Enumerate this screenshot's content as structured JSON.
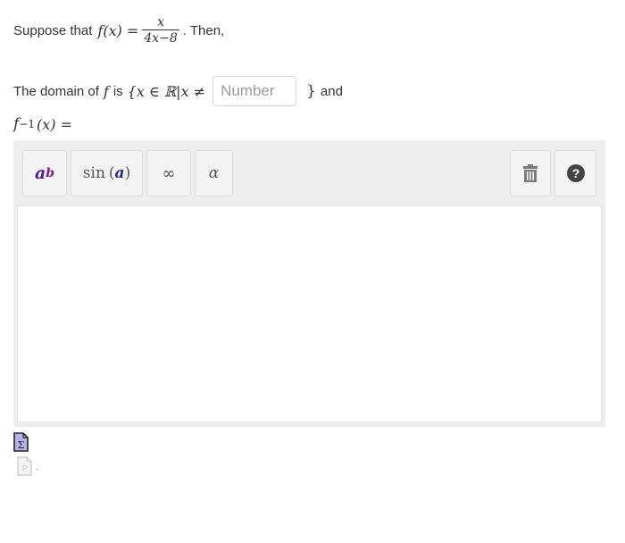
{
  "question": {
    "intro_text": "Suppose that",
    "function_lhs": "f(x) =",
    "fraction_numerator": "x",
    "fraction_denominator": "4x−8",
    "after_text": ". Then,"
  },
  "domain_line": {
    "prefix_text": "The domain of",
    "f_symbol": "f",
    "is_text": "is",
    "set_open": "{x ∈ ℝ|x ≠",
    "input_placeholder": "Number",
    "input_value": "",
    "set_close": "}",
    "and_text": "and"
  },
  "inverse_line": {
    "f": "f",
    "exponent": "−1",
    "rest": "(x) ="
  },
  "editor": {
    "toolbar": {
      "power_base": "a",
      "power_exp": "b",
      "trig_label": "sin",
      "trig_arg": "a",
      "infinity_label": "∞",
      "greek_label": "α",
      "trash_icon": "trash-icon",
      "help_icon": "help-icon"
    },
    "content": ""
  },
  "colors": {
    "power_base": "#4a1f8c",
    "power_exp": "#7b1f86",
    "trig_arg": "#2a2a8c",
    "sigma_icon_fill": "#b8b3ea",
    "toolbar_bg": "#eeeeee"
  },
  "footer": {
    "dot_text": "."
  }
}
